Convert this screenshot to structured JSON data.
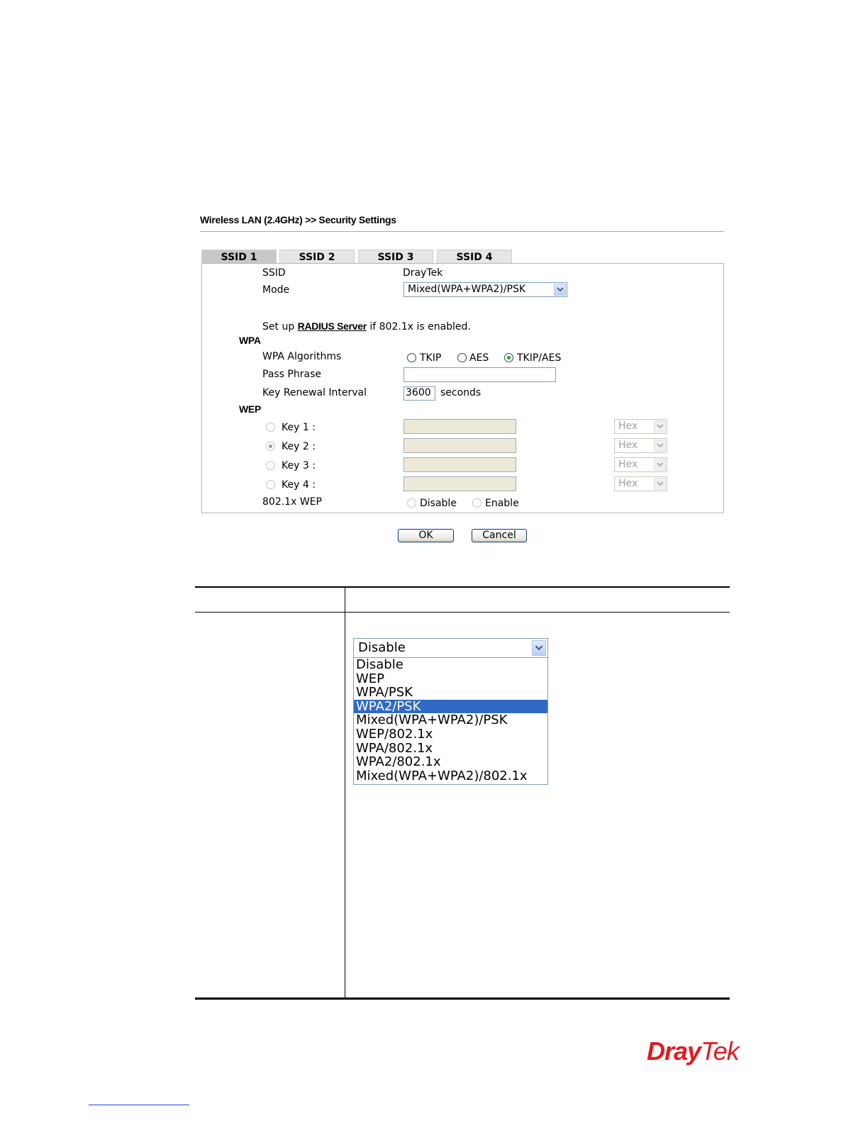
{
  "breadcrumb": "Wireless LAN (2.4GHz) >> Security Settings",
  "tabs": [
    "SSID 1",
    "SSID 2",
    "SSID 3",
    "SSID 4"
  ],
  "form": {
    "ssid_label": "SSID",
    "ssid_value": "DrayTek",
    "mode_label": "Mode",
    "mode_value": "Mixed(WPA+WPA2)/PSK",
    "radius_prefix": "Set up",
    "radius_link": "RADIUS Server",
    "radius_suffix": "if 802.1x is enabled.",
    "wpa_heading": "WPA",
    "wpa_algorithms_label": "WPA Algorithms",
    "wpa_algorithms": [
      "TKIP",
      "AES",
      "TKIP/AES"
    ],
    "wpa_algorithm_selected": "TKIP/AES",
    "pass_phrase_label": "Pass Phrase",
    "pass_phrase_value": "",
    "key_renewal_label": "Key Renewal Interval",
    "key_renewal_value": "3600",
    "key_renewal_unit": "seconds",
    "wep_heading": "WEP",
    "wep_keys": [
      {
        "label": "Key 1 :",
        "format": "Hex",
        "selected": false
      },
      {
        "label": "Key 2 :",
        "format": "Hex",
        "selected": true
      },
      {
        "label": "Key 3 :",
        "format": "Hex",
        "selected": false
      },
      {
        "label": "Key 4 :",
        "format": "Hex",
        "selected": false
      }
    ],
    "wep_8021x_label": "802.1x WEP",
    "wep_8021x_options": [
      "Disable",
      "Enable"
    ]
  },
  "buttons": {
    "ok": "OK",
    "cancel": "Cancel"
  },
  "mode_dropdown": {
    "selected": "Disable",
    "highlighted": "WPA2/PSK",
    "options": [
      "Disable",
      "WEP",
      "WPA/PSK",
      "WPA2/PSK",
      "Mixed(WPA+WPA2)/PSK",
      "WEP/802.1x",
      "WPA/802.1x",
      "WPA2/802.1x",
      "Mixed(WPA+WPA2)/802.1x"
    ]
  },
  "logo": {
    "part1": "Dray",
    "part2": "Tek",
    "color": "#e01b22"
  }
}
